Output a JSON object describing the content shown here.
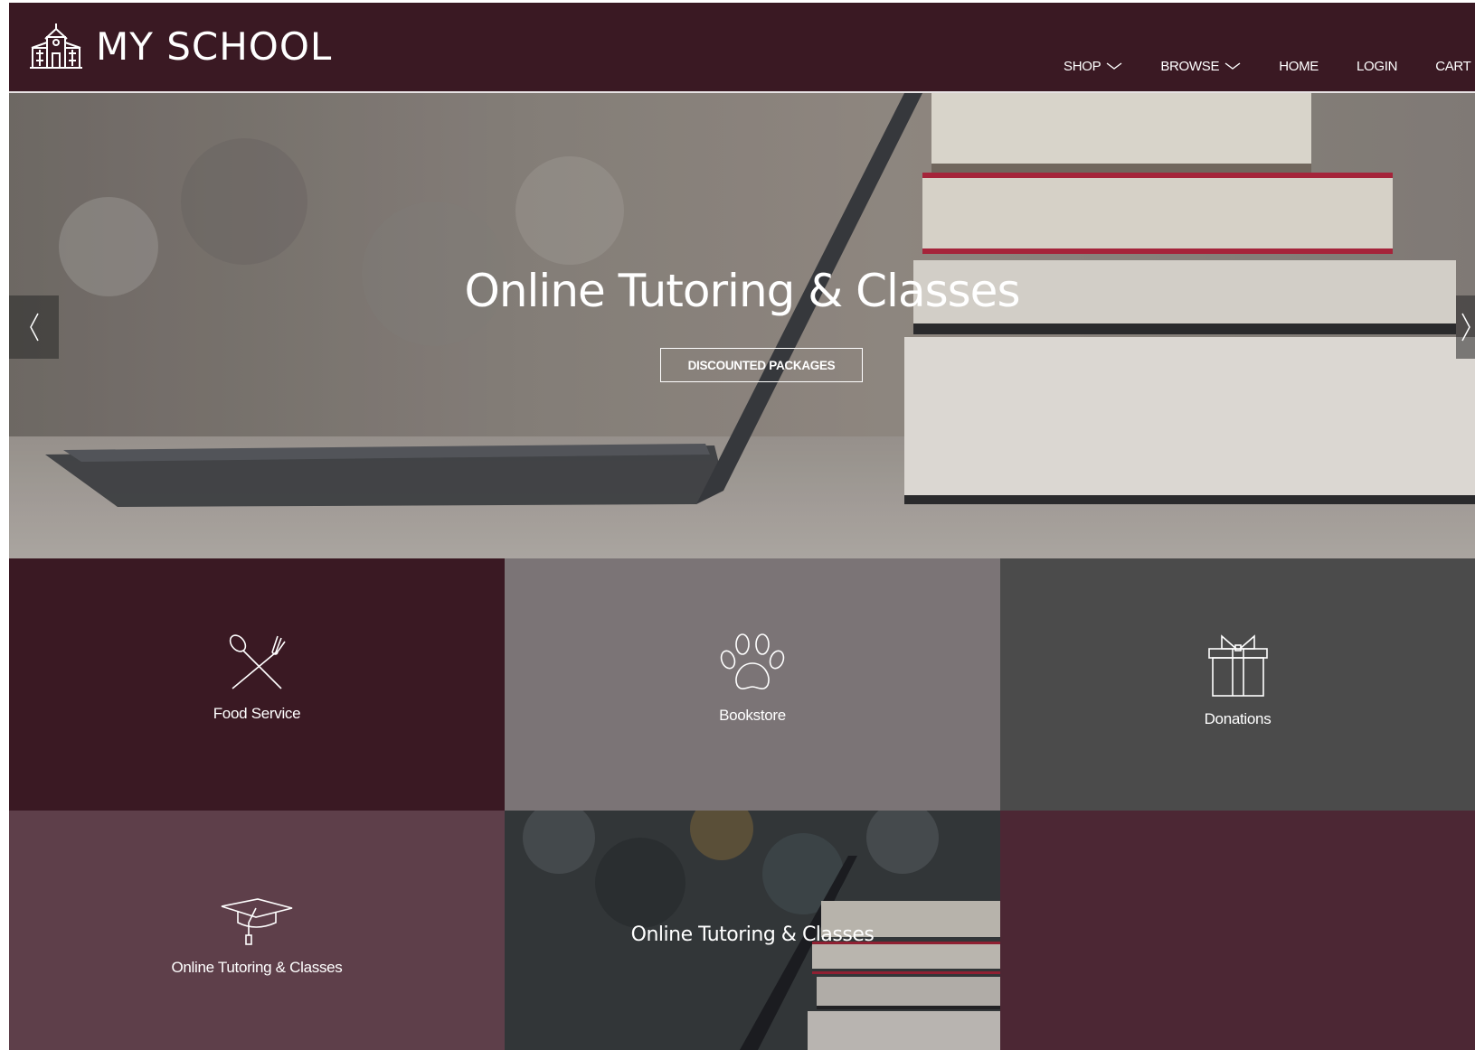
{
  "brand": {
    "name": "MY SCHOOL",
    "icon": "school-building-icon"
  },
  "nav": {
    "items": [
      {
        "label": "SHOP",
        "dropdown": true
      },
      {
        "label": "BROWSE",
        "dropdown": true
      },
      {
        "label": "HOME",
        "dropdown": false
      },
      {
        "label": "LOGIN",
        "dropdown": false
      },
      {
        "label": "CART",
        "dropdown": false
      }
    ]
  },
  "hero": {
    "title": "Online Tutoring & Classes",
    "button_label": "DISCOUNTED PACKAGES",
    "prev_icon": "chevron-left-icon",
    "next_icon": "chevron-right-icon"
  },
  "tiles": [
    {
      "label": "Food Service",
      "icon": "fork-spoon-icon",
      "color": "#3a1923"
    },
    {
      "label": "Bookstore",
      "icon": "paw-print-icon",
      "color": "#7b7476"
    },
    {
      "label": "Donations",
      "icon": "gift-box-icon",
      "color": "#4b4b4b"
    },
    {
      "label": "Online Tutoring & Classes",
      "icon": "graduation-cap-icon",
      "color": "#5e3f4a"
    },
    {
      "label": "Online Tutoring & Classes",
      "icon": "",
      "color": "#3a3a3a"
    },
    {
      "label": "",
      "icon": "",
      "color": "#4c2734"
    }
  ],
  "colors": {
    "primary": "#3a1923",
    "accent_light": "#e8e3e5"
  }
}
